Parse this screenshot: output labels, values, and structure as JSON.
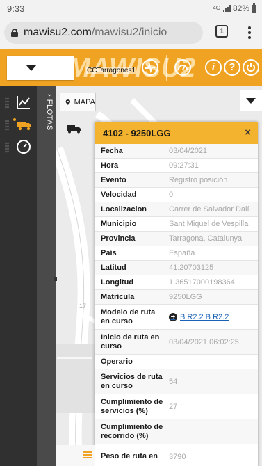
{
  "status_bar": {
    "time": "9:33",
    "network": "4G",
    "battery": "82%"
  },
  "browser": {
    "url_domain": "mawisu2.com",
    "url_path": "/mawisu2/inicio",
    "tab_count": "1"
  },
  "header": {
    "logo_text": "MAWISU2",
    "selected_label": "CCTarragones1",
    "info_icon": "i",
    "help_icon": "?",
    "accent_color": "#f0a323"
  },
  "sidebar": {
    "flotas_label": "FLOTAS",
    "items": [
      {
        "icon": "chart-icon",
        "active": false
      },
      {
        "icon": "truck-icon",
        "active": true
      },
      {
        "icon": "gauge-icon",
        "active": false
      }
    ]
  },
  "map": {
    "tab_label": "MAPA",
    "tile_number": "17"
  },
  "popup": {
    "title": "4102 - 9250LGG",
    "close_glyph": "×",
    "rows": [
      {
        "key": "Fecha",
        "value": "03/04/2021"
      },
      {
        "key": "Hora",
        "value": "09:27:31"
      },
      {
        "key": "Evento",
        "value": "Registro posición"
      },
      {
        "key": "Velocidad",
        "value": "0"
      },
      {
        "key": "Localizacion",
        "value": "Carrer de Salvador Dalí"
      },
      {
        "key": "Municipio",
        "value": "Sant Miquel de Vespilla"
      },
      {
        "key": "Provincia",
        "value": "Tarragona, Catalunya"
      },
      {
        "key": "País",
        "value": "España"
      },
      {
        "key": "Latitud",
        "value": "41.20703125"
      },
      {
        "key": "Longitud",
        "value": "1.36517000198364"
      },
      {
        "key": "Matrícula",
        "value": "9250LGG"
      },
      {
        "key": "Modelo de ruta en curso",
        "value": "B R2.2 B R2.2",
        "link": true
      },
      {
        "key": "Inicio de ruta en curso",
        "value": "03/04/2021 06:02:25"
      },
      {
        "key": "Operario",
        "value": ""
      },
      {
        "key": "Servicios de ruta en curso",
        "value": "54"
      },
      {
        "key": "Cumplimiento de servicios (%)",
        "value": "27"
      },
      {
        "key": "Cumplimiento de recorrido (%)",
        "value": ""
      },
      {
        "key": "Peso de ruta en",
        "value": "3790"
      }
    ]
  }
}
